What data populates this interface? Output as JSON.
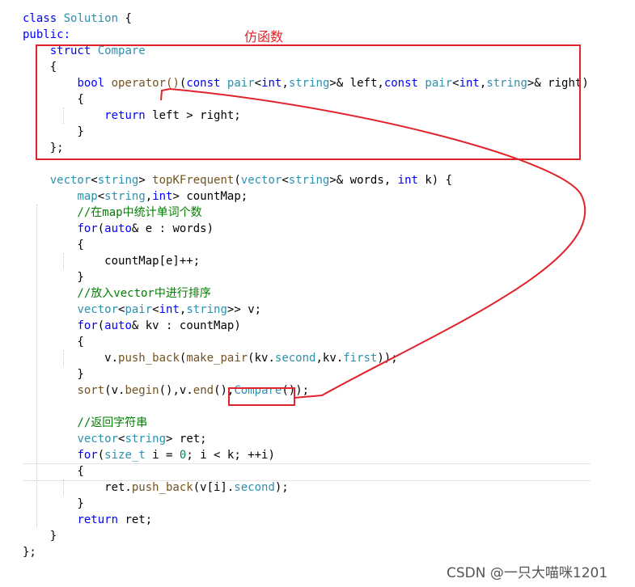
{
  "code": {
    "lines": [
      [
        {
          "t": "class",
          "c": "kw"
        },
        {
          "t": " ",
          "c": "plain"
        },
        {
          "t": "Solution",
          "c": "ty"
        },
        {
          "t": " {",
          "c": "plain"
        }
      ],
      [
        {
          "t": "public:",
          "c": "kw"
        }
      ],
      [
        {
          "t": "    ",
          "c": "plain"
        },
        {
          "t": "struct",
          "c": "kw"
        },
        {
          "t": " ",
          "c": "plain"
        },
        {
          "t": "Compare",
          "c": "ty"
        }
      ],
      [
        {
          "t": "    {",
          "c": "plain"
        }
      ],
      [
        {
          "t": "        ",
          "c": "plain"
        },
        {
          "t": "bool",
          "c": "kw"
        },
        {
          "t": " ",
          "c": "plain"
        },
        {
          "t": "operator()",
          "c": "fn"
        },
        {
          "t": "(",
          "c": "plain"
        },
        {
          "t": "const",
          "c": "kw"
        },
        {
          "t": " ",
          "c": "plain"
        },
        {
          "t": "pair",
          "c": "ty"
        },
        {
          "t": "<",
          "c": "plain"
        },
        {
          "t": "int",
          "c": "kw"
        },
        {
          "t": ",",
          "c": "plain"
        },
        {
          "t": "string",
          "c": "ty"
        },
        {
          "t": ">& left,",
          "c": "plain"
        },
        {
          "t": "const",
          "c": "kw"
        },
        {
          "t": " ",
          "c": "plain"
        },
        {
          "t": "pair",
          "c": "ty"
        },
        {
          "t": "<",
          "c": "plain"
        },
        {
          "t": "int",
          "c": "kw"
        },
        {
          "t": ",",
          "c": "plain"
        },
        {
          "t": "string",
          "c": "ty"
        },
        {
          "t": ">& right)",
          "c": "plain"
        }
      ],
      [
        {
          "t": "        {",
          "c": "plain"
        }
      ],
      [
        {
          "t": "            ",
          "c": "plain"
        },
        {
          "t": "return",
          "c": "kw"
        },
        {
          "t": " left > right;",
          "c": "plain"
        }
      ],
      [
        {
          "t": "        }",
          "c": "plain"
        }
      ],
      [
        {
          "t": "    };",
          "c": "plain"
        }
      ],
      [],
      [
        {
          "t": "    ",
          "c": "plain"
        },
        {
          "t": "vector",
          "c": "ty"
        },
        {
          "t": "<",
          "c": "plain"
        },
        {
          "t": "string",
          "c": "ty"
        },
        {
          "t": "> ",
          "c": "plain"
        },
        {
          "t": "topKFrequent",
          "c": "fn"
        },
        {
          "t": "(",
          "c": "plain"
        },
        {
          "t": "vector",
          "c": "ty"
        },
        {
          "t": "<",
          "c": "plain"
        },
        {
          "t": "string",
          "c": "ty"
        },
        {
          "t": ">& words, ",
          "c": "plain"
        },
        {
          "t": "int",
          "c": "kw"
        },
        {
          "t": " k) {",
          "c": "plain"
        }
      ],
      [
        {
          "t": "        ",
          "c": "plain"
        },
        {
          "t": "map",
          "c": "ty"
        },
        {
          "t": "<",
          "c": "plain"
        },
        {
          "t": "string",
          "c": "ty"
        },
        {
          "t": ",",
          "c": "plain"
        },
        {
          "t": "int",
          "c": "kw"
        },
        {
          "t": "> countMap;",
          "c": "plain"
        }
      ],
      [
        {
          "t": "        //在map中统计单词个数",
          "c": "cm"
        }
      ],
      [
        {
          "t": "        ",
          "c": "plain"
        },
        {
          "t": "for",
          "c": "kw"
        },
        {
          "t": "(",
          "c": "plain"
        },
        {
          "t": "auto",
          "c": "kw"
        },
        {
          "t": "& e : words)",
          "c": "plain"
        }
      ],
      [
        {
          "t": "        {",
          "c": "plain"
        }
      ],
      [
        {
          "t": "            countMap[e]++;",
          "c": "plain"
        }
      ],
      [
        {
          "t": "        }",
          "c": "plain"
        }
      ],
      [
        {
          "t": "        //放入vector中进行排序",
          "c": "cm"
        }
      ],
      [
        {
          "t": "        ",
          "c": "plain"
        },
        {
          "t": "vector",
          "c": "ty"
        },
        {
          "t": "<",
          "c": "plain"
        },
        {
          "t": "pair",
          "c": "ty"
        },
        {
          "t": "<",
          "c": "plain"
        },
        {
          "t": "int",
          "c": "kw"
        },
        {
          "t": ",",
          "c": "plain"
        },
        {
          "t": "string",
          "c": "ty"
        },
        {
          "t": ">> v;",
          "c": "plain"
        }
      ],
      [
        {
          "t": "        ",
          "c": "plain"
        },
        {
          "t": "for",
          "c": "kw"
        },
        {
          "t": "(",
          "c": "plain"
        },
        {
          "t": "auto",
          "c": "kw"
        },
        {
          "t": "& kv : countMap)",
          "c": "plain"
        }
      ],
      [
        {
          "t": "        {",
          "c": "plain"
        }
      ],
      [
        {
          "t": "            v.",
          "c": "plain"
        },
        {
          "t": "push_back",
          "c": "fn"
        },
        {
          "t": "(",
          "c": "plain"
        },
        {
          "t": "make_pair",
          "c": "fn"
        },
        {
          "t": "(kv.",
          "c": "plain"
        },
        {
          "t": "second",
          "c": "ty"
        },
        {
          "t": ",kv.",
          "c": "plain"
        },
        {
          "t": "first",
          "c": "ty"
        },
        {
          "t": "));",
          "c": "plain"
        }
      ],
      [
        {
          "t": "        }",
          "c": "plain"
        }
      ],
      [
        {
          "t": "        ",
          "c": "plain"
        },
        {
          "t": "sort",
          "c": "fn"
        },
        {
          "t": "(v.",
          "c": "plain"
        },
        {
          "t": "begin",
          "c": "fn"
        },
        {
          "t": "(),v.",
          "c": "plain"
        },
        {
          "t": "end",
          "c": "fn"
        },
        {
          "t": "(),",
          "c": "plain"
        },
        {
          "t": "Compare",
          "c": "ty"
        },
        {
          "t": "());",
          "c": "plain"
        }
      ],
      [],
      [
        {
          "t": "        //返回字符串",
          "c": "cm"
        }
      ],
      [
        {
          "t": "        ",
          "c": "plain"
        },
        {
          "t": "vector",
          "c": "ty"
        },
        {
          "t": "<",
          "c": "plain"
        },
        {
          "t": "string",
          "c": "ty"
        },
        {
          "t": "> ret;",
          "c": "plain"
        }
      ],
      [
        {
          "t": "        ",
          "c": "plain"
        },
        {
          "t": "for",
          "c": "kw"
        },
        {
          "t": "(",
          "c": "plain"
        },
        {
          "t": "size_t",
          "c": "ty"
        },
        {
          "t": " i = ",
          "c": "plain"
        },
        {
          "t": "0",
          "c": "nu"
        },
        {
          "t": "; i < k; ++i)",
          "c": "plain"
        }
      ],
      [
        {
          "t": "        {",
          "c": "plain"
        }
      ],
      [
        {
          "t": "            ret.",
          "c": "plain"
        },
        {
          "t": "push_back",
          "c": "fn"
        },
        {
          "t": "(v[i].",
          "c": "plain"
        },
        {
          "t": "second",
          "c": "ty"
        },
        {
          "t": ");",
          "c": "plain"
        }
      ],
      [
        {
          "t": "        }",
          "c": "plain"
        }
      ],
      [
        {
          "t": "        ",
          "c": "plain"
        },
        {
          "t": "return",
          "c": "kw"
        },
        {
          "t": " ret;",
          "c": "plain"
        }
      ],
      [
        {
          "t": "    }",
          "c": "plain"
        }
      ],
      [
        {
          "t": "};",
          "c": "plain"
        }
      ]
    ]
  },
  "annotation": {
    "label": "仿函数",
    "color": "#e1242b"
  },
  "watermark": "CSDN @一只大喵咪1201"
}
